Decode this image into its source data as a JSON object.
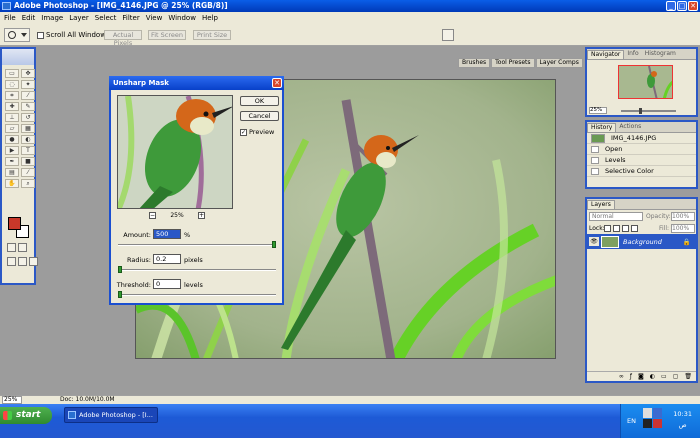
{
  "titlebar": {
    "title": "Adobe Photoshop - [IMG_4146.JPG @ 25% (RGB/8)]",
    "min": "_",
    "max": "□",
    "close": "✕"
  },
  "menu": [
    "File",
    "Edit",
    "Image",
    "Layer",
    "Select",
    "Filter",
    "View",
    "Window",
    "Help"
  ],
  "options": {
    "scroll_all": "Scroll All Windows",
    "actual_pixels": "Actual Pixels",
    "fit_screen": "Fit Screen",
    "print_size": "Print Size",
    "well_tabs": [
      "Brushes",
      "Tool Presets",
      "Layer Comps"
    ]
  },
  "dialog": {
    "title": "Unsharp Mask",
    "close": "✕",
    "ok": "OK",
    "cancel": "Cancel",
    "preview_label": "Preview",
    "zoom": "25%",
    "zoom_minus": "−",
    "zoom_plus": "+",
    "amount_label": "Amount:",
    "amount_value": "500",
    "amount_unit": "%",
    "amount_fraction": 1.0,
    "radius_label": "Radius:",
    "radius_value": "0.2",
    "radius_unit": "pixels",
    "radius_fraction": 0.0,
    "threshold_label": "Threshold:",
    "threshold_value": "0",
    "threshold_unit": "levels",
    "threshold_fraction": 0.0
  },
  "navigator": {
    "tabs": [
      "Navigator",
      "Info",
      "Histogram"
    ],
    "zoom": "25%"
  },
  "history": {
    "tabs": [
      "History",
      "Actions"
    ],
    "snapshot": "IMG_4146.JPG",
    "steps": [
      "Open",
      "Levels",
      "Selective Color"
    ]
  },
  "layers": {
    "tabs": [
      "Layers"
    ],
    "blend_mode": "Normal",
    "opacity_label": "Opacity:",
    "opacity_value": "100%",
    "lock_label": "Lock:",
    "fill_label": "Fill:",
    "fill_value": "100%",
    "layer_name": "Background"
  },
  "status": {
    "zoom": "25%",
    "doc": "Doc: 10.0M/10.0M"
  },
  "taskbar": {
    "start": "start",
    "task": "Adobe Photoshop - [I...",
    "lang": "EN",
    "time": "10:31",
    "period": "ص"
  },
  "colors": {
    "foreground": "#c8382a",
    "background": "#ffffff",
    "accent": "#2b58c6"
  }
}
